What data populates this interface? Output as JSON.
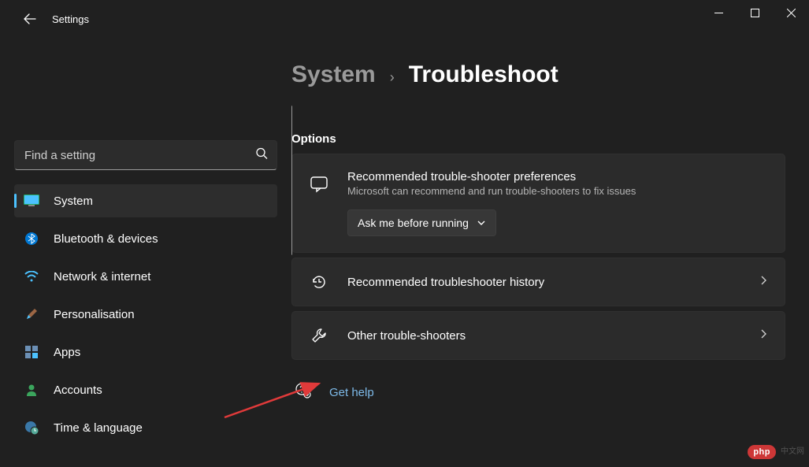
{
  "app": {
    "title": "Settings"
  },
  "search": {
    "placeholder": "Find a setting"
  },
  "nav": {
    "items": [
      {
        "label": "System"
      },
      {
        "label": "Bluetooth & devices"
      },
      {
        "label": "Network & internet"
      },
      {
        "label": "Personalisation"
      },
      {
        "label": "Apps"
      },
      {
        "label": "Accounts"
      },
      {
        "label": "Time & language"
      }
    ]
  },
  "breadcrumb": {
    "parent": "System",
    "sep": "›",
    "current": "Troubleshoot"
  },
  "options": {
    "label": "Options",
    "recommended": {
      "title": "Recommended trouble-shooter preferences",
      "sub": "Microsoft can recommend and run trouble-shooters to fix issues",
      "dropdown_value": "Ask me before running"
    },
    "history": {
      "title": "Recommended troubleshooter history"
    },
    "other": {
      "title": "Other trouble-shooters"
    }
  },
  "help": {
    "label": "Get help"
  },
  "watermark": {
    "label": "php",
    "cn": "中文网"
  }
}
